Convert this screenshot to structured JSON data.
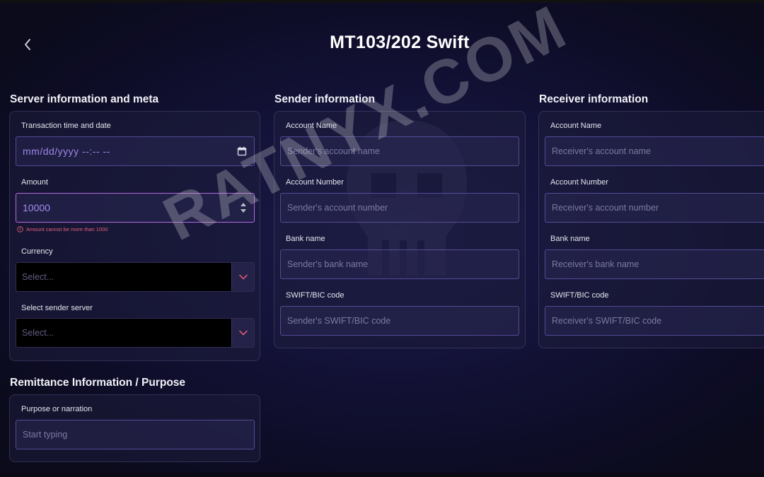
{
  "page": {
    "title": "MT103/202 Swift"
  },
  "watermark": "RATNYX.COM",
  "colors": {
    "accent": "#9b86e8",
    "error": "#e0607a",
    "background": "#0d0d1f"
  },
  "server_section": {
    "title": "Server information and meta",
    "transaction_label": "Transaction time and date",
    "transaction_value": "mm/dd/yyyy --:-- --",
    "amount_label": "Amount",
    "amount_value": "10000",
    "amount_error": "Amount cannot be more than 1000",
    "currency_label": "Currency",
    "currency_placeholder": "Select...",
    "server_label": "Select sender server",
    "server_placeholder": "Select..."
  },
  "remittance_section": {
    "title": "Remittance Information / Purpose",
    "purpose_label": "Purpose or narration",
    "purpose_placeholder": "Start typing"
  },
  "sender_section": {
    "title": "Sender information",
    "account_name_label": "Account Name",
    "account_name_placeholder": "Sender's account name",
    "account_number_label": "Account Number",
    "account_number_placeholder": "Sender's account number",
    "bank_name_label": "Bank name",
    "bank_name_placeholder": "Sender's bank name",
    "swift_label": "SWIFT/BIC code",
    "swift_placeholder": "Sender's SWIFT/BIC code"
  },
  "receiver_section": {
    "title": "Receiver information",
    "account_name_label": "Account Name",
    "account_name_placeholder": "Receiver's account name",
    "account_number_label": "Account Number",
    "account_number_placeholder": "Receiver's account number",
    "bank_name_label": "Bank name",
    "bank_name_placeholder": "Receiver's bank name",
    "swift_label": "SWIFT/BIC code",
    "swift_placeholder": "Receiver's SWIFT/BIC code"
  },
  "icons": {
    "back": "chevron-left-icon",
    "calendar": "calendar-icon",
    "stepper": "stepper-icon",
    "dropdown": "chevron-down-icon",
    "error": "alert-circle-icon"
  }
}
